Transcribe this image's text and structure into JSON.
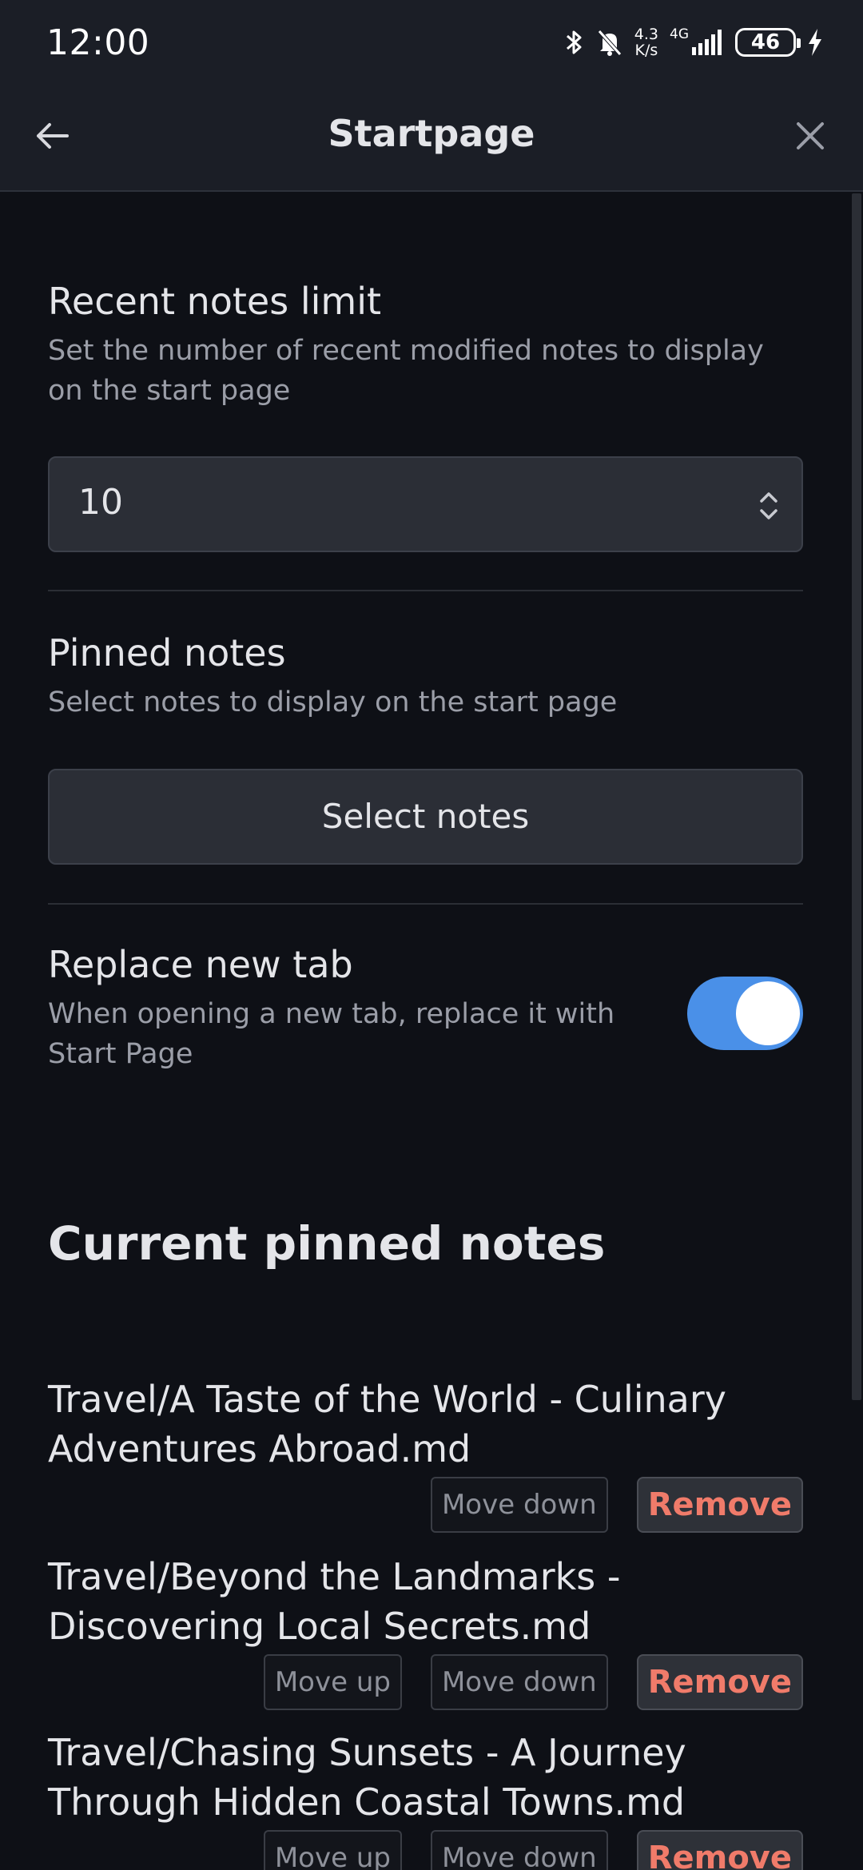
{
  "status_bar": {
    "time": "12:00",
    "net_speed_value": "4.3",
    "net_speed_unit": "K/s",
    "network": "4G",
    "battery": "46",
    "icons": [
      "bluetooth-icon",
      "mute-icon",
      "signal-icon",
      "charging-icon"
    ]
  },
  "header": {
    "title": "Startpage",
    "back_icon": "arrow-left-icon",
    "close_icon": "close-icon"
  },
  "settings": {
    "recent": {
      "name": "Recent notes limit",
      "desc": "Set the number of recent modified notes to display on the start page",
      "value": "10"
    },
    "pinned": {
      "name": "Pinned notes",
      "desc": "Select notes to display on the start page",
      "button": "Select notes"
    },
    "replace_tab": {
      "name": "Replace new tab",
      "desc": "When opening a new tab, replace it with Start Page",
      "enabled": true
    }
  },
  "pinned_section": {
    "title": "Current pinned notes",
    "items": [
      {
        "title": "Travel/A Taste of the World - Culinary Adventures Abroad.md",
        "move_down": "Move down",
        "remove": "Remove"
      },
      {
        "title": "Travel/Beyond the Landmarks - Discovering Local Secrets.md",
        "move_up": "Move up",
        "move_down": "Move down",
        "remove": "Remove"
      },
      {
        "title": "Travel/Chasing Sunsets - A Journey Through Hidden Coastal Towns.md",
        "move_up": "Move up",
        "move_down": "Move down",
        "remove": "Remove"
      }
    ]
  },
  "colors": {
    "accent": "#4a90e8",
    "remove": "#f07b6a",
    "background": "#0e1016",
    "header": "#1b1e26"
  }
}
